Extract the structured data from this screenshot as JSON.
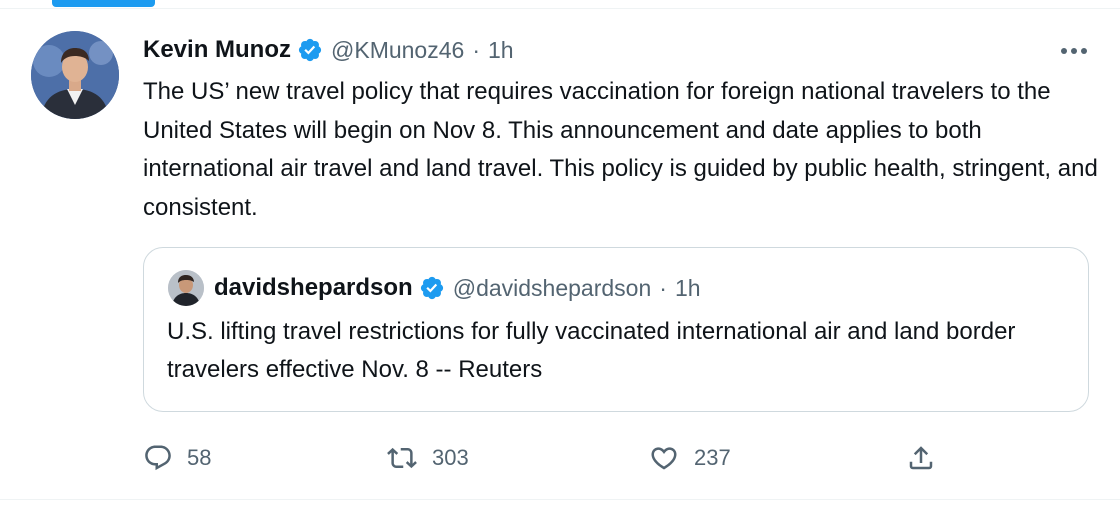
{
  "tweet": {
    "author": {
      "display_name": "Kevin Munoz",
      "handle": "@KMunoz46",
      "verified": true
    },
    "separator": "·",
    "time": "1h",
    "text": "The US’ new travel policy that requires vaccination for foreign national travelers to the United States will begin on Nov 8. This announcement and date applies to both international air travel and land travel. This policy is guided by public health, stringent, and consistent.",
    "quote": {
      "display_name": "davidshepardson",
      "handle": "@davidshepardson",
      "verified": true,
      "separator": "·",
      "time": "1h",
      "text": "U.S. lifting travel restrictions for fully vaccinated international air and land border travelers effective Nov. 8 -- Reuters"
    },
    "actions": {
      "replies": "58",
      "retweets": "303",
      "likes": "237"
    }
  },
  "icons": {
    "more": "more-horizontal-icon",
    "reply": "reply-icon",
    "retweet": "retweet-icon",
    "like": "heart-icon",
    "share": "share-icon",
    "verified": "verified-badge-icon"
  },
  "colors": {
    "accent": "#1d9bf0",
    "text_primary": "#0f1419",
    "text_secondary": "#536471",
    "border": "#cfd9de"
  }
}
